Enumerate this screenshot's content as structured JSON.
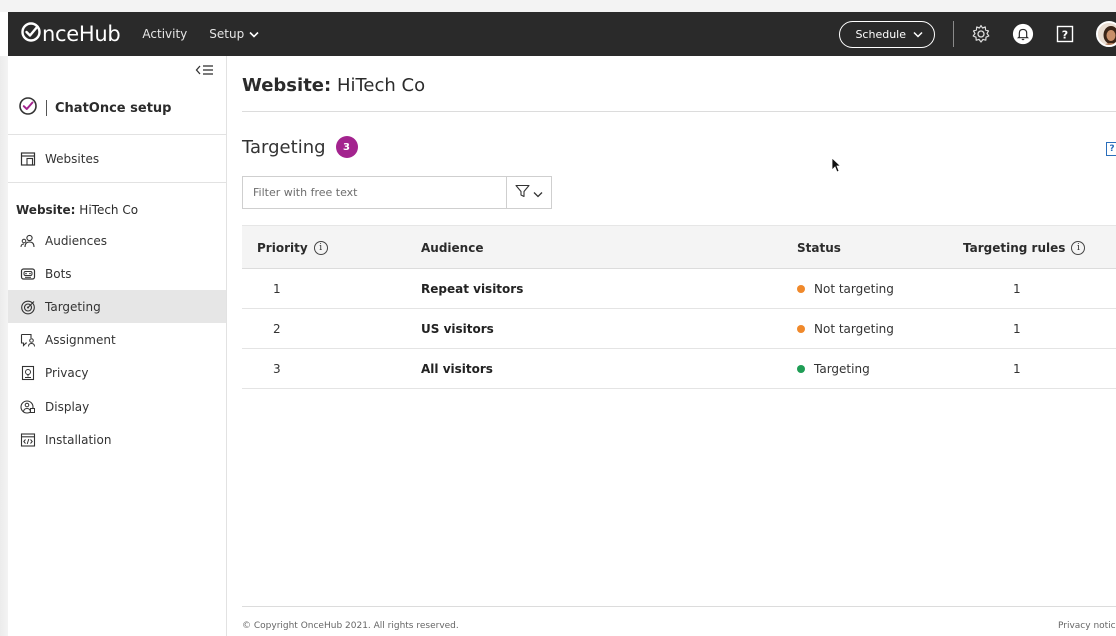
{
  "topbar": {
    "logo_text_o": "O",
    "logo_text_rest": "nceHub",
    "nav": [
      {
        "label": "Activity"
      },
      {
        "label": "Setup"
      }
    ],
    "schedule_label": "Schedule"
  },
  "sidebar": {
    "setup_title": "ChatOnce setup",
    "websites_label": "Websites",
    "website_prefix": "Website:",
    "website_name": "HiTech Co",
    "items": [
      {
        "label": "Audiences",
        "icon": "audiences-icon"
      },
      {
        "label": "Bots",
        "icon": "bot-icon"
      },
      {
        "label": "Targeting",
        "icon": "targeting-icon",
        "active": true
      },
      {
        "label": "Assignment",
        "icon": "assignment-icon"
      },
      {
        "label": "Privacy",
        "icon": "privacy-icon"
      },
      {
        "label": "Display",
        "icon": "display-icon"
      },
      {
        "label": "Installation",
        "icon": "installation-icon"
      }
    ]
  },
  "main": {
    "title_prefix": "Website:",
    "title_name": "HiTech Co",
    "section_title": "Targeting",
    "count": "3",
    "filter_placeholder": "Filter with free text",
    "columns": {
      "priority": "Priority",
      "audience": "Audience",
      "status": "Status",
      "rules": "Targeting rules"
    },
    "rows": [
      {
        "priority": "1",
        "audience": "Repeat visitors",
        "status": "Not targeting",
        "status_color": "#f0892b",
        "rules": "1"
      },
      {
        "priority": "2",
        "audience": "US visitors",
        "status": "Not targeting",
        "status_color": "#f0892b",
        "rules": "1"
      },
      {
        "priority": "3",
        "audience": "All visitors",
        "status": "Targeting",
        "status_color": "#1f9d55",
        "rules": "1"
      }
    ]
  },
  "footer": {
    "copyright": "© Copyright OnceHub 2021. All rights reserved.",
    "privacy": "Privacy notice"
  },
  "colors": {
    "topbar": "#2a2a2a",
    "badge": "#a3238e",
    "not_targeting": "#f0892b",
    "targeting": "#1f9d55",
    "active_item": "#e6e6e6"
  }
}
